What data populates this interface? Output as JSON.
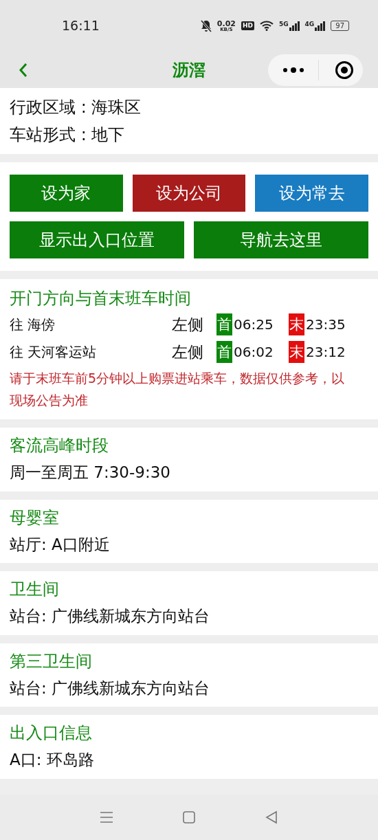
{
  "status_bar": {
    "time": "16:11",
    "speed": "0.02",
    "speed_unit": "KB/S",
    "hd": "HD",
    "net1": "5G",
    "net2": "4G",
    "battery": "97"
  },
  "nav": {
    "title": "沥滘"
  },
  "info": [
    "行政区域 : 海珠区",
    "车站形式 : 地下"
  ],
  "button_rows": [
    [
      {
        "label": "设为家",
        "color": "#0a7d0a"
      },
      {
        "label": "设为公司",
        "color": "#a81c1c"
      },
      {
        "label": "设为常去",
        "color": "#1a7cc1"
      }
    ],
    [
      {
        "label": "显示出入口位置",
        "color": "#0a7d0a"
      },
      {
        "label": "导航去这里",
        "color": "#0a7d0a"
      }
    ]
  ],
  "schedule": {
    "title": "开门方向与首末班车时间",
    "rows": [
      {
        "direction": "往 海傍",
        "side": "左侧",
        "first_tag": "首",
        "first": "06:25",
        "last_tag": "末",
        "last": "23:35"
      },
      {
        "direction": "往 天河客运站",
        "side": "左侧",
        "first_tag": "首",
        "first": "06:02",
        "last_tag": "末",
        "last": "23:12"
      }
    ],
    "note": "请于末班车前5分钟以上购票进站乘车，数据仅供参考，以现场公告为准"
  },
  "sections": [
    {
      "title": "客流高峰时段",
      "text": "周一至周五 7:30-9:30"
    },
    {
      "title": "母婴室",
      "text": "站厅: A口附近"
    },
    {
      "title": "卫生间",
      "text": "站台: 广佛线新城东方向站台"
    },
    {
      "title": "第三卫生间",
      "text": "站台: 广佛线新城东方向站台"
    },
    {
      "title": "出入口信息",
      "text": "A口: 环岛路"
    }
  ]
}
